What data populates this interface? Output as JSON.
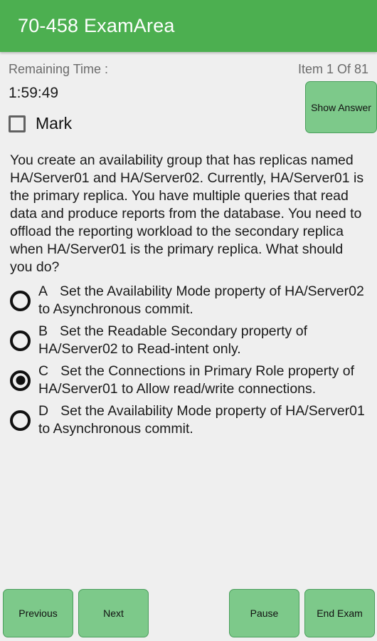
{
  "app": {
    "title": "70-458 ExamArea",
    "header_color": "#4CAF50",
    "button_color": "#7DC98A",
    "background_color": "#EFEFEF"
  },
  "status": {
    "remaining_time_label": "Remaining Time :",
    "item_counter": "Item  1  Of  81",
    "timer_value": "1:59:49"
  },
  "mark": {
    "label": "Mark",
    "checked": false
  },
  "show_answer": {
    "label": "Show Answer"
  },
  "question": {
    "text": "You create an availability group that has replicas named HA/Server01 and HA/Server02. Currently, HA/Server01 is the primary replica. You have multiple queries that read data and produce reports from the database. You need to offload the reporting workload to the secondary replica when HA/Server01 is the primary replica. What should you do?"
  },
  "options": [
    {
      "letter": "A",
      "text": "Set the Availability Mode property of HA/Server02 to Asynchronous commit.",
      "selected": false
    },
    {
      "letter": "B",
      "text": "Set the Readable Secondary property of HA/Server02 to Read-intent only.",
      "selected": false
    },
    {
      "letter": "C",
      "text": "Set the Connections in Primary Role property of HA/Server01 to Allow read/write connections.",
      "selected": true
    },
    {
      "letter": "D",
      "text": "Set the Availability Mode property of HA/Server01 to Asynchronous commit.",
      "selected": false
    }
  ],
  "buttons": {
    "previous": "Previous",
    "next": "Next",
    "pause": "Pause",
    "end_exam": "End Exam"
  }
}
